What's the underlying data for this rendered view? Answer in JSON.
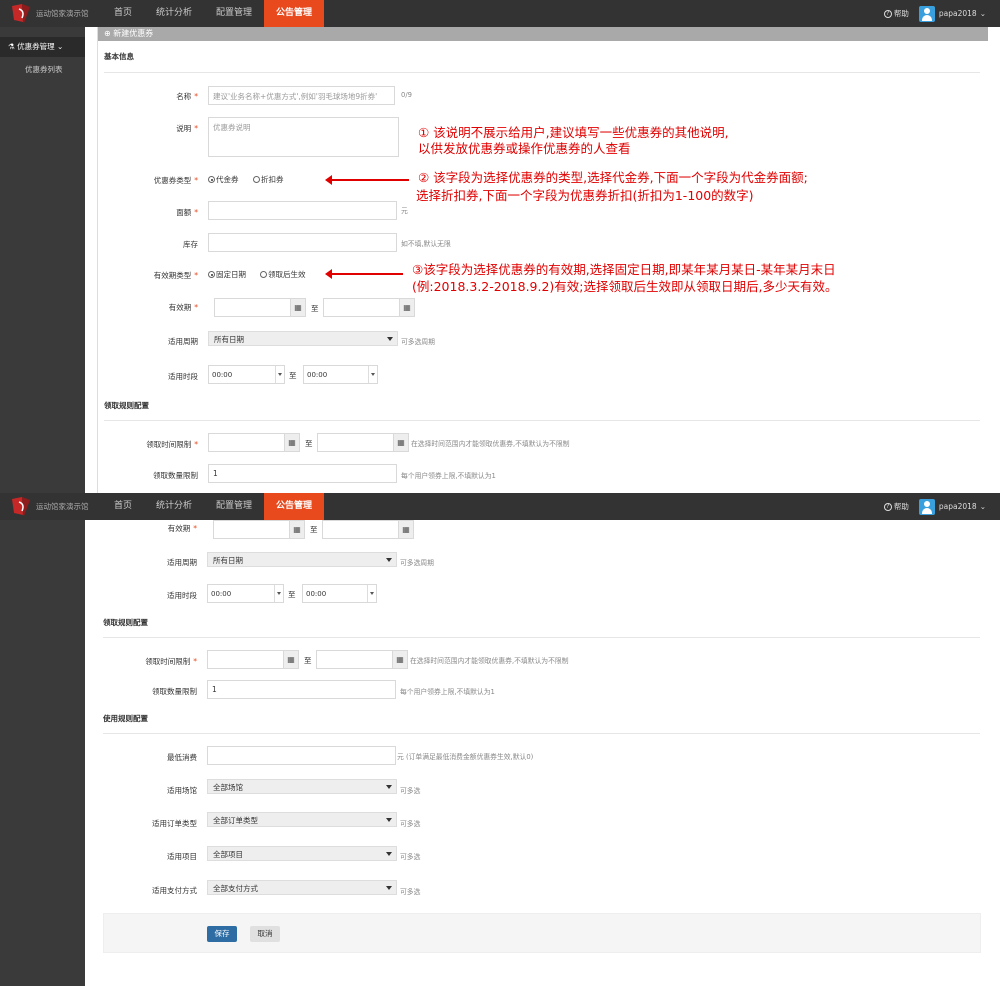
{
  "nav": {
    "brand": "运动馆家演示馆",
    "items": [
      "首页",
      "统计分析",
      "配置管理",
      "公告管理"
    ],
    "help": "帮助",
    "user": "papa2018"
  },
  "sidebar": {
    "menu": "优惠券管理",
    "sub": "优惠券列表"
  },
  "panel_title": "新建优惠券",
  "sections": {
    "basic": "基本信息",
    "receive": "领取规则配置",
    "use": "使用规则配置"
  },
  "fields": {
    "name": {
      "label": "名称",
      "placeholder": "建议'业务名称+优惠方式',例如'羽毛球场地9折券'",
      "counter": "0/9"
    },
    "desc": {
      "label": "说明",
      "placeholder": "优惠券说明"
    },
    "type": {
      "label": "优惠券类型",
      "options": [
        "代金券",
        "折扣券"
      ]
    },
    "amount": {
      "label": "面额",
      "unit": "元"
    },
    "stock": {
      "label": "库存",
      "hint": "如不填,默认无限"
    },
    "validity_type": {
      "label": "有效期类型",
      "options": [
        "固定日期",
        "领取后生效"
      ]
    },
    "validity": {
      "label": "有效期",
      "to": "至"
    },
    "week": {
      "label": "适用周期",
      "value": "所有日期",
      "hint": "可多选周期"
    },
    "time": {
      "label": "适用时段",
      "from": "00:00",
      "to_value": "00:00",
      "to": "至"
    },
    "receive_time": {
      "label": "领取时间限制",
      "to": "至",
      "hint": "在选择时间范围内才能领取优惠券,不填默认为不限制"
    },
    "receive_limit": {
      "label": "领取数量限制",
      "value": "1",
      "hint": "每个用户领券上限,不填默认为1"
    },
    "min_spend": {
      "label": "最低消费",
      "hint": "元 (订单满足最低消费金额优惠券生效,默认0)"
    },
    "scene": {
      "label": "适用场馆",
      "value": "全部场馆",
      "hint": "可多选"
    },
    "order_type": {
      "label": "适用订单类型",
      "value": "全部订单类型",
      "hint": "可多选"
    },
    "item": {
      "label": "适用项目",
      "value": "全部项目",
      "hint": "可多选"
    },
    "pay": {
      "label": "适用支付方式",
      "value": "全部支付方式",
      "hint": "可多选"
    }
  },
  "buttons": {
    "save": "保存",
    "cancel": "取消"
  },
  "annotations": {
    "a1_line1": "① 该说明不展示给用户,建议填写一些优惠券的其他说明,",
    "a1_line2": "以供发放优惠券或操作优惠券的人查看",
    "a2_line1": "② 该字段为选择优惠券的类型,选择代金券,下面一个字段为代金券面额;",
    "a2_line2": "选择折扣券,下面一个字段为优惠券折扣(折扣为1-100的数字)",
    "a3_line1": "③该字段为选择优惠券的有效期,选择固定日期,即某年某月某日-某年某月末日",
    "a3_line2": "(例:2018.3.2-2018.9.2)有效;选择领取后生效即从领取日期后,多少天有效。"
  },
  "colors": {
    "nav_bg": "#333333",
    "active_tab": "#e8491d",
    "sidebar_bg": "#3a3a3a",
    "annotation": "#e00000",
    "save_btn": "#2e6da4"
  }
}
